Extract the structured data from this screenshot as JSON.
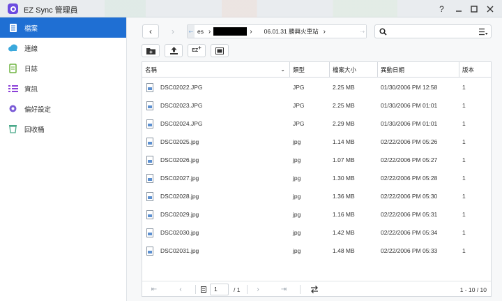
{
  "window": {
    "title": "EZ Sync 管理員",
    "controls": [
      "help-icon",
      "minimize-icon",
      "maximize-icon",
      "close-icon"
    ],
    "help_label": "?"
  },
  "sidebar": {
    "items": [
      {
        "label": "檔案",
        "icon": "files-icon",
        "active": true
      },
      {
        "label": "連線",
        "icon": "cloud-icon",
        "active": false
      },
      {
        "label": "日誌",
        "icon": "log-icon",
        "active": false
      },
      {
        "label": "資訊",
        "icon": "info-list-icon",
        "active": false
      },
      {
        "label": "偏好設定",
        "icon": "gear-icon",
        "active": false
      },
      {
        "label": "回收桶",
        "icon": "recycle-bin-icon",
        "active": false
      }
    ]
  },
  "toolbar": {
    "back_label": "‹",
    "forward_label": "›",
    "breadcrumb": {
      "first_segment": "es",
      "last_segment": "06.01.31 勝興火車站"
    },
    "search": {
      "placeholder": "",
      "value": ""
    },
    "actions": [
      "new-folder-icon",
      "upload-icon",
      "ez-add-icon",
      "select-all-icon"
    ],
    "ez_label": "EZ"
  },
  "table": {
    "columns": [
      "名稱",
      "類型",
      "檔案大小",
      "異動日期",
      "版本"
    ],
    "rows": [
      {
        "name": "DSC02022.JPG",
        "type": "JPG",
        "size": "2.25 MB",
        "date": "01/30/2006 PM 12:58",
        "version": "1"
      },
      {
        "name": "DSC02023.JPG",
        "type": "JPG",
        "size": "2.25 MB",
        "date": "01/30/2006 PM 01:01",
        "version": "1"
      },
      {
        "name": "DSC02024.JPG",
        "type": "JPG",
        "size": "2.29 MB",
        "date": "01/30/2006 PM 01:01",
        "version": "1"
      },
      {
        "name": "DSC02025.jpg",
        "type": "jpg",
        "size": "1.14 MB",
        "date": "02/22/2006 PM 05:26",
        "version": "1"
      },
      {
        "name": "DSC02026.jpg",
        "type": "jpg",
        "size": "1.07 MB",
        "date": "02/22/2006 PM 05:27",
        "version": "1"
      },
      {
        "name": "DSC02027.jpg",
        "type": "jpg",
        "size": "1.30 MB",
        "date": "02/22/2006 PM 05:28",
        "version": "1"
      },
      {
        "name": "DSC02028.jpg",
        "type": "jpg",
        "size": "1.36 MB",
        "date": "02/22/2006 PM 05:30",
        "version": "1"
      },
      {
        "name": "DSC02029.jpg",
        "type": "jpg",
        "size": "1.16 MB",
        "date": "02/22/2006 PM 05:31",
        "version": "1"
      },
      {
        "name": "DSC02030.jpg",
        "type": "jpg",
        "size": "1.42 MB",
        "date": "02/22/2006 PM 05:34",
        "version": "1"
      },
      {
        "name": "DSC02031.jpg",
        "type": "jpg",
        "size": "1.48 MB",
        "date": "02/22/2006 PM 05:33",
        "version": "1"
      }
    ]
  },
  "pager": {
    "page": "1",
    "total_pages": "/ 1",
    "summary": "1 - 10 / 10"
  },
  "colors": {
    "accent": "#1f6fd3",
    "app_icon": "#6c4ce0"
  }
}
